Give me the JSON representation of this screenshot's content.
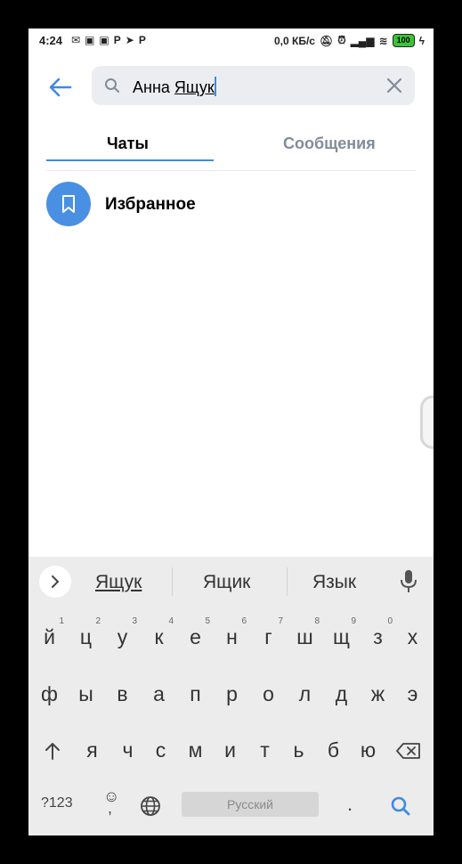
{
  "status_bar": {
    "time": "4:24",
    "left_icons": [
      "notification-icon",
      "app-icon",
      "app-icon",
      "p-icon",
      "telegram-icon",
      "p-icon"
    ],
    "network_speed": "0,0 КБ/с",
    "battery": "100"
  },
  "search": {
    "query_plain": "Анна ",
    "query_underlined": "Ящук"
  },
  "tabs": [
    {
      "label": "Чаты"
    },
    {
      "label": "Сообщения"
    }
  ],
  "results": [
    {
      "title": "Избранное"
    }
  ],
  "keyboard": {
    "suggestions": [
      "Ящук",
      "Ящик",
      "Язык"
    ],
    "row1": [
      "й",
      "ц",
      "у",
      "к",
      "е",
      "н",
      "г",
      "ш",
      "щ",
      "з",
      "х"
    ],
    "row1_hints": [
      "1",
      "2",
      "3",
      "4",
      "5",
      "6",
      "7",
      "8",
      "9",
      "0",
      ""
    ],
    "row2": [
      "ф",
      "ы",
      "в",
      "а",
      "п",
      "р",
      "о",
      "л",
      "д",
      "ж",
      "э"
    ],
    "row3": [
      "я",
      "ч",
      "с",
      "м",
      "и",
      "т",
      "ь",
      "б",
      "ю"
    ],
    "symbols_label": "?123",
    "space_label": "Русский",
    "period": "."
  },
  "colors": {
    "accent": "#3f8ae0",
    "avatar": "#4a90e2",
    "search_bg": "#ebedf0",
    "keyboard_bg": "#ececec"
  }
}
